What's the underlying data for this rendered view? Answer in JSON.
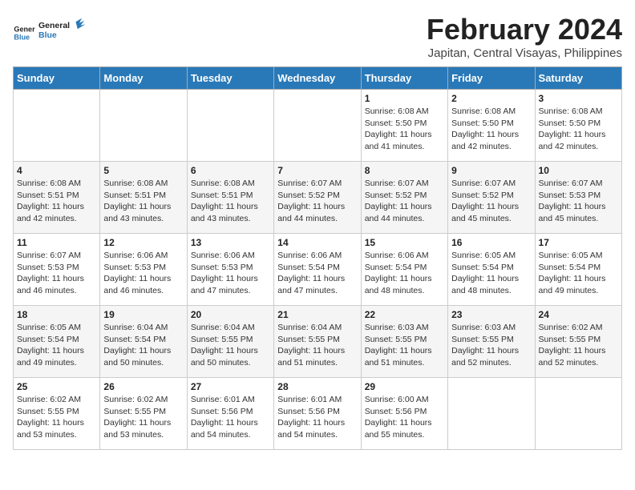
{
  "header": {
    "logo_line1": "General",
    "logo_line2": "Blue",
    "title": "February 2024",
    "subtitle": "Japitan, Central Visayas, Philippines"
  },
  "weekdays": [
    "Sunday",
    "Monday",
    "Tuesday",
    "Wednesday",
    "Thursday",
    "Friday",
    "Saturday"
  ],
  "weeks": [
    [
      {
        "day": "",
        "info": ""
      },
      {
        "day": "",
        "info": ""
      },
      {
        "day": "",
        "info": ""
      },
      {
        "day": "",
        "info": ""
      },
      {
        "day": "1",
        "info": "Sunrise: 6:08 AM\nSunset: 5:50 PM\nDaylight: 11 hours\nand 41 minutes."
      },
      {
        "day": "2",
        "info": "Sunrise: 6:08 AM\nSunset: 5:50 PM\nDaylight: 11 hours\nand 42 minutes."
      },
      {
        "day": "3",
        "info": "Sunrise: 6:08 AM\nSunset: 5:50 PM\nDaylight: 11 hours\nand 42 minutes."
      }
    ],
    [
      {
        "day": "4",
        "info": "Sunrise: 6:08 AM\nSunset: 5:51 PM\nDaylight: 11 hours\nand 42 minutes."
      },
      {
        "day": "5",
        "info": "Sunrise: 6:08 AM\nSunset: 5:51 PM\nDaylight: 11 hours\nand 43 minutes."
      },
      {
        "day": "6",
        "info": "Sunrise: 6:08 AM\nSunset: 5:51 PM\nDaylight: 11 hours\nand 43 minutes."
      },
      {
        "day": "7",
        "info": "Sunrise: 6:07 AM\nSunset: 5:52 PM\nDaylight: 11 hours\nand 44 minutes."
      },
      {
        "day": "8",
        "info": "Sunrise: 6:07 AM\nSunset: 5:52 PM\nDaylight: 11 hours\nand 44 minutes."
      },
      {
        "day": "9",
        "info": "Sunrise: 6:07 AM\nSunset: 5:52 PM\nDaylight: 11 hours\nand 45 minutes."
      },
      {
        "day": "10",
        "info": "Sunrise: 6:07 AM\nSunset: 5:53 PM\nDaylight: 11 hours\nand 45 minutes."
      }
    ],
    [
      {
        "day": "11",
        "info": "Sunrise: 6:07 AM\nSunset: 5:53 PM\nDaylight: 11 hours\nand 46 minutes."
      },
      {
        "day": "12",
        "info": "Sunrise: 6:06 AM\nSunset: 5:53 PM\nDaylight: 11 hours\nand 46 minutes."
      },
      {
        "day": "13",
        "info": "Sunrise: 6:06 AM\nSunset: 5:53 PM\nDaylight: 11 hours\nand 47 minutes."
      },
      {
        "day": "14",
        "info": "Sunrise: 6:06 AM\nSunset: 5:54 PM\nDaylight: 11 hours\nand 47 minutes."
      },
      {
        "day": "15",
        "info": "Sunrise: 6:06 AM\nSunset: 5:54 PM\nDaylight: 11 hours\nand 48 minutes."
      },
      {
        "day": "16",
        "info": "Sunrise: 6:05 AM\nSunset: 5:54 PM\nDaylight: 11 hours\nand 48 minutes."
      },
      {
        "day": "17",
        "info": "Sunrise: 6:05 AM\nSunset: 5:54 PM\nDaylight: 11 hours\nand 49 minutes."
      }
    ],
    [
      {
        "day": "18",
        "info": "Sunrise: 6:05 AM\nSunset: 5:54 PM\nDaylight: 11 hours\nand 49 minutes."
      },
      {
        "day": "19",
        "info": "Sunrise: 6:04 AM\nSunset: 5:54 PM\nDaylight: 11 hours\nand 50 minutes."
      },
      {
        "day": "20",
        "info": "Sunrise: 6:04 AM\nSunset: 5:55 PM\nDaylight: 11 hours\nand 50 minutes."
      },
      {
        "day": "21",
        "info": "Sunrise: 6:04 AM\nSunset: 5:55 PM\nDaylight: 11 hours\nand 51 minutes."
      },
      {
        "day": "22",
        "info": "Sunrise: 6:03 AM\nSunset: 5:55 PM\nDaylight: 11 hours\nand 51 minutes."
      },
      {
        "day": "23",
        "info": "Sunrise: 6:03 AM\nSunset: 5:55 PM\nDaylight: 11 hours\nand 52 minutes."
      },
      {
        "day": "24",
        "info": "Sunrise: 6:02 AM\nSunset: 5:55 PM\nDaylight: 11 hours\nand 52 minutes."
      }
    ],
    [
      {
        "day": "25",
        "info": "Sunrise: 6:02 AM\nSunset: 5:55 PM\nDaylight: 11 hours\nand 53 minutes."
      },
      {
        "day": "26",
        "info": "Sunrise: 6:02 AM\nSunset: 5:55 PM\nDaylight: 11 hours\nand 53 minutes."
      },
      {
        "day": "27",
        "info": "Sunrise: 6:01 AM\nSunset: 5:56 PM\nDaylight: 11 hours\nand 54 minutes."
      },
      {
        "day": "28",
        "info": "Sunrise: 6:01 AM\nSunset: 5:56 PM\nDaylight: 11 hours\nand 54 minutes."
      },
      {
        "day": "29",
        "info": "Sunrise: 6:00 AM\nSunset: 5:56 PM\nDaylight: 11 hours\nand 55 minutes."
      },
      {
        "day": "",
        "info": ""
      },
      {
        "day": "",
        "info": ""
      }
    ]
  ]
}
